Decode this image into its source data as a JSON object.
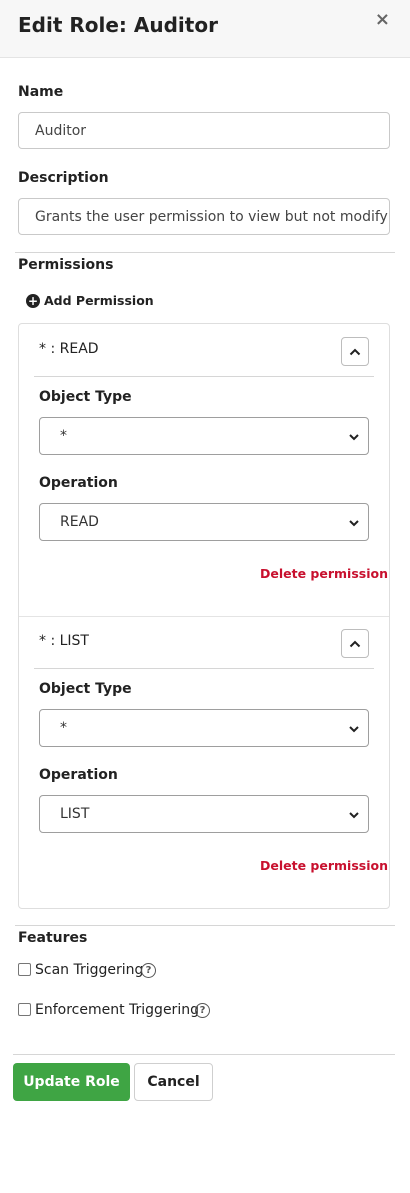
{
  "dialog": {
    "title": "Edit Role: Auditor",
    "close_label": "×"
  },
  "form": {
    "name_label": "Name",
    "name_value": "Auditor",
    "description_label": "Description",
    "description_value": "Grants the user permission to view but not modify"
  },
  "permissions": {
    "section_label": "Permissions",
    "add_label": "Add Permission",
    "items": [
      {
        "title": "* : READ",
        "object_type_label": "Object Type",
        "object_type_value": "*",
        "operation_label": "Operation",
        "operation_value": "READ",
        "delete_label": "Delete permission"
      },
      {
        "title": "* : LIST",
        "object_type_label": "Object Type",
        "object_type_value": "*",
        "operation_label": "Operation",
        "operation_value": "LIST",
        "delete_label": "Delete permission"
      }
    ]
  },
  "features": {
    "section_label": "Features",
    "items": [
      {
        "label": "Scan Triggering",
        "checked": false
      },
      {
        "label": "Enforcement Triggering",
        "checked": false
      }
    ]
  },
  "actions": {
    "update_label": "Update Role",
    "cancel_label": "Cancel"
  },
  "colors": {
    "primary": "#3fa544",
    "danger": "#c8102e"
  }
}
